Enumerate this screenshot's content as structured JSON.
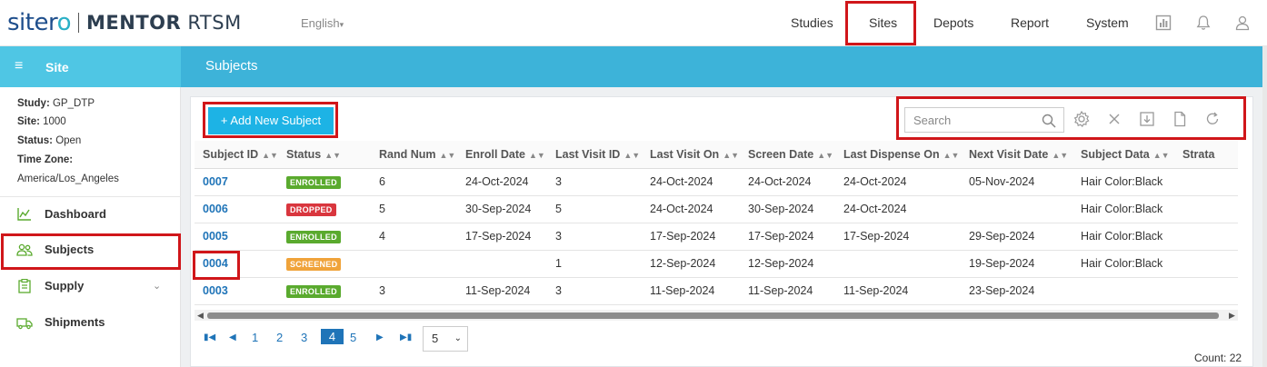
{
  "brand": {
    "name_main": "siter",
    "name_o": "o",
    "product_bold": "MENTOR",
    "product_light": "RTSM"
  },
  "language": {
    "label": "English"
  },
  "topnav": {
    "items": [
      "Studies",
      "Sites",
      "Depots",
      "Report",
      "System"
    ],
    "active": "Sites"
  },
  "icons": [
    "report-icon",
    "bell-icon",
    "user-icon",
    "menu-icon",
    "search-icon",
    "gear-icon",
    "close-icon",
    "download-icon",
    "document-icon",
    "refresh-icon",
    "dashboard-icon",
    "subjects-icon",
    "supply-icon",
    "shipments-icon"
  ],
  "sidebar": {
    "title": "Site",
    "info": {
      "study_label": "Study:",
      "study": "GP_DTP",
      "site_label": "Site:",
      "site": "1000",
      "status_label": "Status:",
      "status": "Open",
      "tz_label": "Time Zone:",
      "tz": "America/Los_Angeles"
    },
    "items": [
      {
        "label": "Dashboard"
      },
      {
        "label": "Subjects"
      },
      {
        "label": "Supply"
      },
      {
        "label": "Shipments"
      }
    ]
  },
  "page": {
    "title": "Subjects"
  },
  "toolbar": {
    "add_label": "+ Add New Subject",
    "search_placeholder": "Search"
  },
  "table": {
    "columns": [
      "Subject ID",
      "Status",
      "Rand Num",
      "Enroll Date",
      "Last Visit ID",
      "Last Visit On",
      "Screen Date",
      "Last Dispense On",
      "Next Visit Date",
      "Subject Data",
      "Strata"
    ],
    "rows": [
      [
        "0007",
        "ENROLLED",
        "6",
        "24-Oct-2024",
        "3",
        "24-Oct-2024",
        "24-Oct-2024",
        "24-Oct-2024",
        "05-Nov-2024",
        "Hair Color:Black",
        ""
      ],
      [
        "0006",
        "DROPPED",
        "5",
        "30-Sep-2024",
        "5",
        "24-Oct-2024",
        "30-Sep-2024",
        "24-Oct-2024",
        "",
        "Hair Color:Black",
        ""
      ],
      [
        "0005",
        "ENROLLED",
        "4",
        "17-Sep-2024",
        "3",
        "17-Sep-2024",
        "17-Sep-2024",
        "17-Sep-2024",
        "29-Sep-2024",
        "Hair Color:Black",
        ""
      ],
      [
        "0004",
        "SCREENED",
        "",
        "",
        "1",
        "12-Sep-2024",
        "12-Sep-2024",
        "",
        "19-Sep-2024",
        "Hair Color:Black",
        ""
      ],
      [
        "0003",
        "ENROLLED",
        "3",
        "11-Sep-2024",
        "3",
        "11-Sep-2024",
        "11-Sep-2024",
        "11-Sep-2024",
        "23-Sep-2024",
        "",
        ""
      ]
    ]
  },
  "status_colors": {
    "ENROLLED": "#5aaa2e",
    "DROPPED": "#d9363e",
    "SCREENED": "#f0a33a"
  },
  "pager": {
    "pages": [
      "1",
      "2",
      "3",
      "4",
      "5"
    ],
    "current": "4",
    "page_size": "5"
  },
  "count": {
    "text": "Count: 22"
  }
}
